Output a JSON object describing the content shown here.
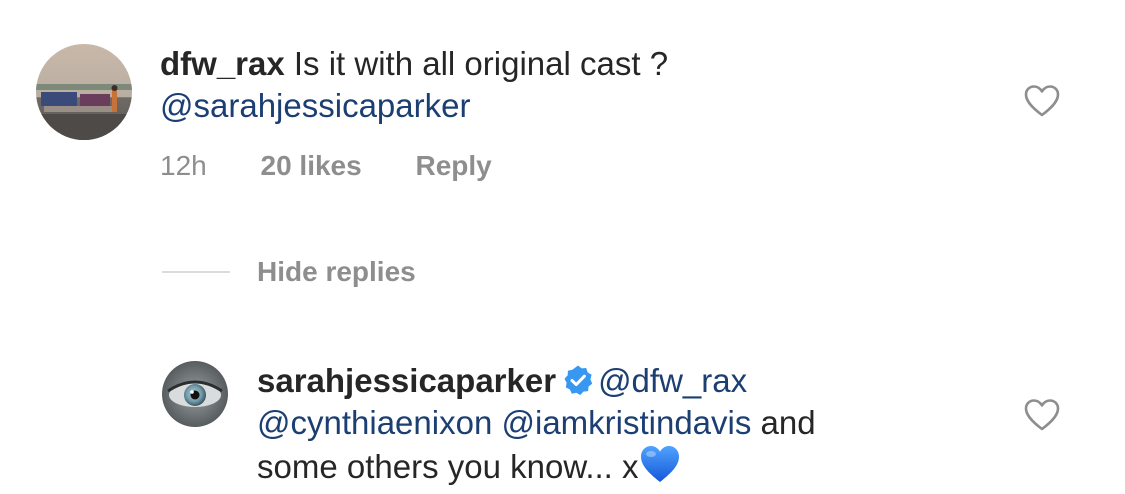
{
  "comment1": {
    "avatar_icon": "user-avatar-outdoor-photo",
    "username": "dfw_rax",
    "text": "Is it with all original cast ?",
    "mention": "@sarahjessicaparker",
    "time": "12h",
    "likes": "20 likes",
    "reply": "Reply",
    "like_icon": "heart-outline-icon"
  },
  "hide_replies": {
    "label": "Hide replies"
  },
  "comment2": {
    "avatar_icon": "user-avatar-eye-photo",
    "username": "sarahjessicaparker",
    "verified_icon": "verified-badge-icon",
    "mention1": "@dfw_rax",
    "mention2": "@cynthiaenixon",
    "mention3": "@iamkristindavis",
    "text1": "and",
    "text2": "some others you know... x",
    "emoji": "blue-heart-emoji",
    "like_icon": "heart-outline-icon"
  },
  "colors": {
    "text": "#262626",
    "mention": "#1c3f73",
    "meta": "#8e8e8e",
    "verified": "#3897f0",
    "blue_heart": "#1d6ff0"
  }
}
